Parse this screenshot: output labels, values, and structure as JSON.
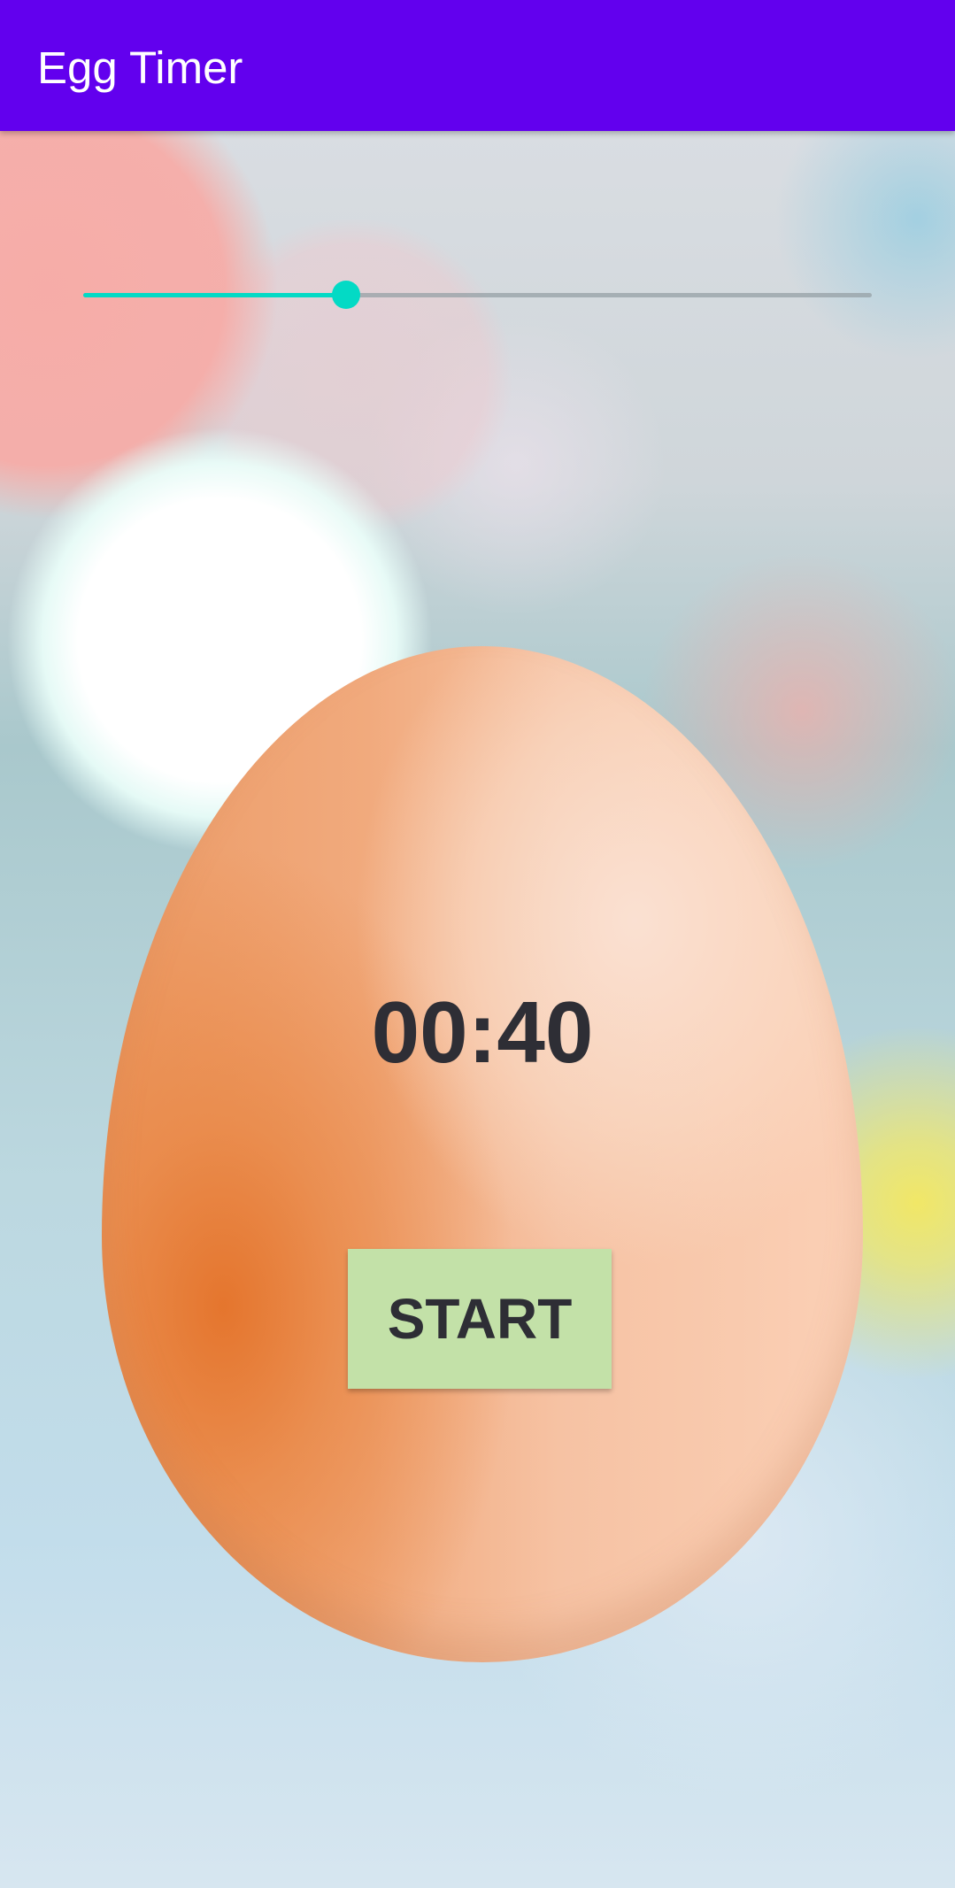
{
  "app_bar": {
    "title": "Egg Timer",
    "color": "#6200ee"
  },
  "seekbar": {
    "progress_fraction": 0.333,
    "accent_color": "#03dac5"
  },
  "timer": {
    "display": "00:40"
  },
  "start_button": {
    "label": "START",
    "color": "#c3e1a8"
  }
}
